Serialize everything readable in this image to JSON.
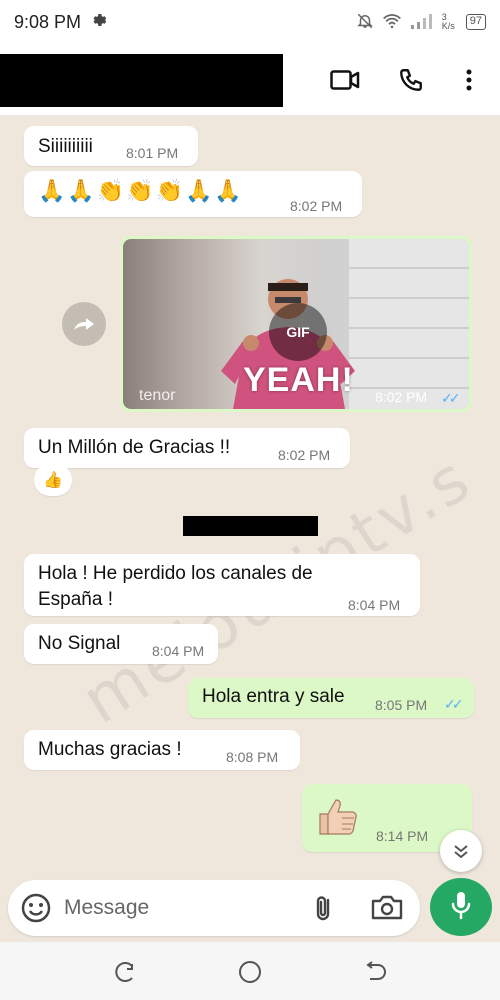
{
  "status_bar": {
    "time": "9:08 PM",
    "network_speed": "3 K/s",
    "battery": "97"
  },
  "header": {
    "contact_name_redacted": true,
    "icons": [
      "video-call-icon",
      "voice-call-icon",
      "more-options-icon"
    ]
  },
  "messages": [
    {
      "direction": "in",
      "text": "Siiiiiiiiii",
      "time": "8:01 PM"
    },
    {
      "direction": "in",
      "text": "🙏🙏👏👏👏🙏🙏",
      "time": "8:02 PM"
    },
    {
      "direction": "out",
      "type": "gif",
      "gif_caption": "YEAH!",
      "gif_source": "tenor",
      "gif_badge": "GIF",
      "time": "8:02 PM",
      "read": true
    },
    {
      "direction": "in",
      "text": "Un Millón de Gracias !!",
      "time": "8:02 PM",
      "reaction": "👍"
    },
    {
      "direction": "in",
      "text": "Hola ! He perdido los canales de",
      "text2": "España !",
      "time": "8:04 PM"
    },
    {
      "direction": "in",
      "text": "No Signal",
      "time": "8:04 PM"
    },
    {
      "direction": "out",
      "text": "Hola entra y sale",
      "time": "8:05 PM",
      "read": true
    },
    {
      "direction": "in",
      "text": "Muchas gracias !",
      "time": "8:08 PM"
    },
    {
      "direction": "out",
      "text": "👍🏻",
      "time": "8:14 PM"
    }
  ],
  "watermark": "melouriptv.s",
  "input": {
    "placeholder": "Message"
  },
  "colors": {
    "outgoing_bubble": "#dcf8c6",
    "incoming_bubble": "#ffffff",
    "chat_bg": "#efe7dc",
    "mic_button": "#25a864",
    "read_ticks": "#4fb3f6"
  }
}
